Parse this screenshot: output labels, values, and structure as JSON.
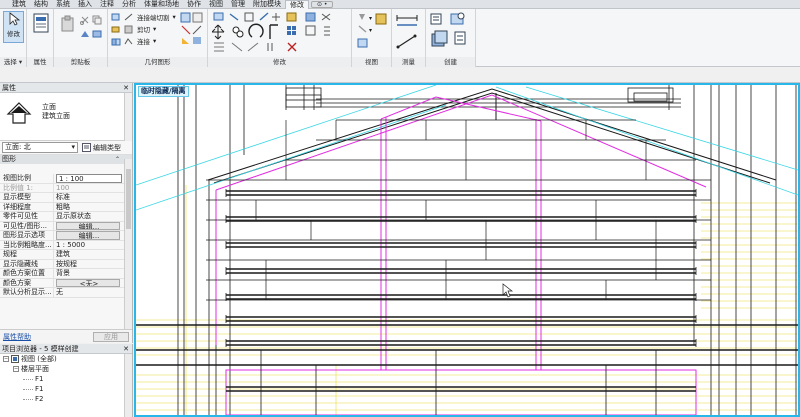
{
  "ribbon": {
    "tabs": [
      "建筑",
      "结构",
      "系统",
      "插入",
      "注释",
      "分析",
      "体量和场地",
      "协作",
      "视图",
      "管理",
      "附加模块",
      "修改"
    ],
    "active_tab": "修改",
    "extra_tab": "⊙ •",
    "panels": {
      "select": "选择 ▾",
      "properties": "属性",
      "clipboard": "剪贴板",
      "geometry": "几何图形",
      "modify": "修改",
      "view": "视图",
      "measure": "测量",
      "create": "创建"
    },
    "modify_button": "修改",
    "geometry_items": [
      "连接端切割",
      "剪切",
      "连接"
    ],
    "geometry_drops": [
      "▾",
      "▾",
      "▾"
    ]
  },
  "properties_palette": {
    "title": "属性",
    "close": "✕",
    "type_name_line1": "立面",
    "type_name_line2": "建筑立面",
    "view_selector": "立面: 北",
    "edit_type": "编辑类型",
    "group": "图形",
    "group_collapse": "⌃",
    "rows": [
      {
        "k": "视图比例",
        "v": "1 : 100",
        "style": "boxed"
      },
      {
        "k": "比例值 1:",
        "v": "100",
        "style": "grey"
      },
      {
        "k": "显示模型",
        "v": "标准",
        "style": ""
      },
      {
        "k": "详细程度",
        "v": "粗略",
        "style": ""
      },
      {
        "k": "零件可见性",
        "v": "显示原状态",
        "style": ""
      },
      {
        "k": "可见性/图形...",
        "v": "编辑...",
        "style": "btn"
      },
      {
        "k": "图形显示选项",
        "v": "编辑...",
        "style": "btn"
      },
      {
        "k": "当比例粗略度...",
        "v": "1 : 5000",
        "style": ""
      },
      {
        "k": "规程",
        "v": "建筑",
        "style": ""
      },
      {
        "k": "显示隐藏线",
        "v": "按规程",
        "style": ""
      },
      {
        "k": "颜色方案位置",
        "v": "背景",
        "style": ""
      },
      {
        "k": "颜色方案",
        "v": "<无>",
        "style": "btn"
      },
      {
        "k": "默认分析显示...",
        "v": "无",
        "style": ""
      }
    ],
    "help_link": "属性帮助",
    "apply": "应用"
  },
  "project_browser": {
    "title": "项目浏览器 - 5 模样创建",
    "close": "✕",
    "items": [
      {
        "label": "视图 (全部)",
        "level": 0,
        "toggle": "−",
        "icon": true
      },
      {
        "label": "楼层平面",
        "level": 1,
        "toggle": "−",
        "icon": false
      },
      {
        "label": "F1",
        "level": 2,
        "toggle": "",
        "icon": false
      },
      {
        "label": "F1",
        "level": 2,
        "toggle": "",
        "icon": false
      },
      {
        "label": "F2",
        "level": 2,
        "toggle": "",
        "icon": false
      }
    ]
  },
  "canvas": {
    "temp_label": "临时隐藏/隔离"
  },
  "colors": {
    "accent": "#29b6e8",
    "magenta": "#e02ee0",
    "cyan": "#38d6e6",
    "yellow": "#e8dc3c"
  }
}
